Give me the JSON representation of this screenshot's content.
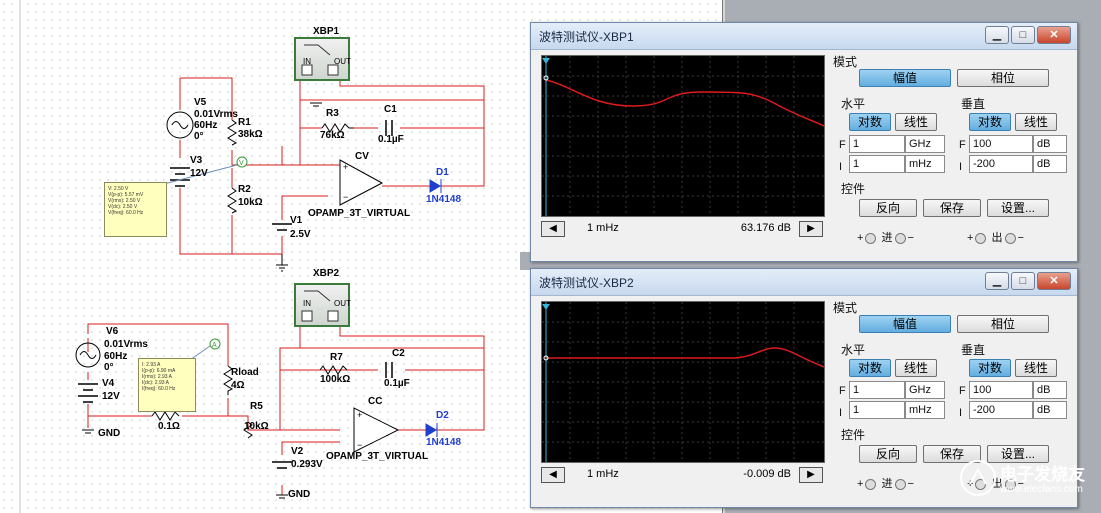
{
  "schematic": {
    "top": {
      "source_name": "V5",
      "source_amp": "0.01Vrms",
      "source_freq": "60Hz",
      "source_phase": "0°",
      "dc_name": "V3",
      "dc_value": "12V",
      "r1_name": "R1",
      "r1_value": "38kΩ",
      "r2_name": "R2",
      "r2_value": "10kΩ",
      "r3_name": "R3",
      "r3_value": "76kΩ",
      "c1_name": "C1",
      "c1_value": "0.1µF",
      "v1_name": "V1",
      "v1_value": "2.5V",
      "opamp_name": "CV",
      "opamp_model": "OPAMP_3T_VIRTUAL",
      "diode_name": "D1",
      "diode_model": "1N4148",
      "probe_name": "XBP1",
      "probe_in": "IN",
      "probe_out": "OUT",
      "probe_note": [
        "V: 2.50 V",
        "V(p-p): 5.57 mV",
        "V(rms): 2.50 V",
        "V(dc): 2.50 V",
        "V(freq): 60.0 Hz"
      ]
    },
    "bottom": {
      "source_name": "V6",
      "source_amp": "0.01Vrms",
      "source_freq": "60Hz",
      "source_phase": "0°",
      "dc_name": "V4",
      "dc_value": "12V",
      "r_small_value": "0.1Ω",
      "rload_name": "Rload",
      "rload_value": "4Ω",
      "r5_name": "R5",
      "r5_value": "10kΩ",
      "r7_name": "R7",
      "r7_value": "100kΩ",
      "c2_name": "C2",
      "c2_value": "0.1µF",
      "v2_name": "V2",
      "v2_value": "0.293V",
      "opamp_name": "CC",
      "opamp_model": "OPAMP_3T_VIRTUAL",
      "diode_name": "D2",
      "diode_model": "1N4148",
      "probe_name": "XBP2",
      "probe_in": "IN",
      "probe_out": "OUT",
      "gnd1": "GND",
      "gnd2": "GND",
      "probe_note": [
        "I: 2.93 A",
        "I(p-p): 6.90 mA",
        "I(rms): 2.93 A",
        "I(dc): 2.93 A",
        "I(freq): 60.0 Hz"
      ]
    }
  },
  "windows": [
    {
      "title": "波特测试仪-XBP1",
      "cursor_freq": "1 mHz",
      "cursor_value": "63.176 dB",
      "mode_label": "模式",
      "magnitude_btn": "幅值",
      "phase_btn": "相位",
      "horizontal_label": "水平",
      "vertical_label": "垂直",
      "log_btn": "对数",
      "lin_btn": "线性",
      "h_final": "1",
      "h_final_unit": "GHz",
      "h_initial": "1",
      "h_initial_unit": "mHz",
      "v_final": "100",
      "v_final_unit": "dB",
      "v_initial": "-200",
      "v_initial_unit": "dB",
      "f_label": "F",
      "i_label": "I",
      "controls_label": "控件",
      "reverse_btn": "反向",
      "save_btn": "保存",
      "settings_btn": "设置...",
      "in_label": "进",
      "out_label": "出",
      "plus": "+",
      "minus": "−"
    },
    {
      "title": "波特测试仪-XBP2",
      "cursor_freq": "1 mHz",
      "cursor_value": "-0.009 dB",
      "mode_label": "模式",
      "magnitude_btn": "幅值",
      "phase_btn": "相位",
      "horizontal_label": "水平",
      "vertical_label": "垂直",
      "log_btn": "对数",
      "lin_btn": "线性",
      "h_final": "1",
      "h_final_unit": "GHz",
      "h_initial": "1",
      "h_initial_unit": "mHz",
      "v_final": "100",
      "v_final_unit": "dB",
      "v_initial": "-200",
      "v_initial_unit": "dB",
      "f_label": "F",
      "i_label": "I",
      "controls_label": "控件",
      "reverse_btn": "反向",
      "save_btn": "保存",
      "settings_btn": "设置...",
      "in_label": "进",
      "out_label": "出",
      "plus": "+",
      "minus": "−"
    }
  ],
  "watermark": {
    "site": "电子发烧友",
    "url": "www.elecfans.com"
  },
  "colors": {
    "wire": "#d81e1e",
    "blue": "#1f3fd0",
    "trace": "#e01a1a",
    "active_button": "#63ade0"
  }
}
